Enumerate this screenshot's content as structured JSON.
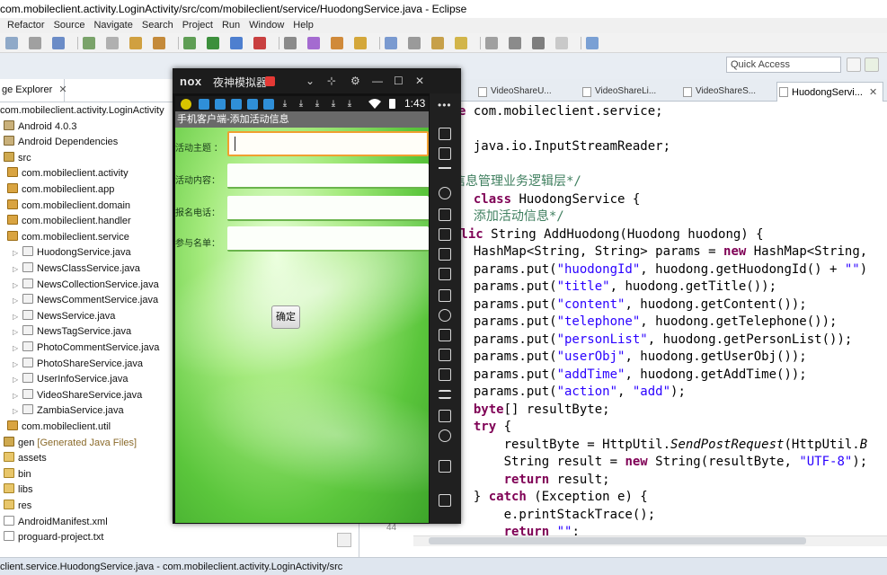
{
  "window": {
    "title": "com.mobileclient.activity.LoginActivity/src/com/mobileclient/service/HuodongService.java - Eclipse"
  },
  "menu": [
    "Refactor",
    "Source",
    "Navigate",
    "Search",
    "Project",
    "Run",
    "Window",
    "Help"
  ],
  "quick_access": {
    "placeholder": "Quick Access"
  },
  "package_explorer": {
    "tab_label": "ge Explorer",
    "close": "✕",
    "items": [
      {
        "label": "com.mobileclient.activity.LoginActivity",
        "kind": "project",
        "indent": 0
      },
      {
        "label": "Android 4.0.3",
        "kind": "lib",
        "indent": 1
      },
      {
        "label": "Android Dependencies",
        "kind": "lib",
        "indent": 1
      },
      {
        "label": "src",
        "kind": "src",
        "indent": 1
      },
      {
        "label": "com.mobileclient.activity",
        "kind": "pkg",
        "indent": 2
      },
      {
        "label": "com.mobileclient.app",
        "kind": "pkg",
        "indent": 2
      },
      {
        "label": "com.mobileclient.domain",
        "kind": "pkg",
        "indent": 2
      },
      {
        "label": "com.mobileclient.handler",
        "kind": "pkg",
        "indent": 2
      },
      {
        "label": "com.mobileclient.service",
        "kind": "pkg",
        "indent": 2
      },
      {
        "label": "HuodongService.java",
        "kind": "java",
        "indent": 3
      },
      {
        "label": "NewsClassService.java",
        "kind": "java",
        "indent": 3
      },
      {
        "label": "NewsCollectionService.java",
        "kind": "java",
        "indent": 3
      },
      {
        "label": "NewsCommentService.java",
        "kind": "java",
        "indent": 3
      },
      {
        "label": "NewsService.java",
        "kind": "java",
        "indent": 3
      },
      {
        "label": "NewsTagService.java",
        "kind": "java",
        "indent": 3
      },
      {
        "label": "PhotoCommentService.java",
        "kind": "java",
        "indent": 3
      },
      {
        "label": "PhotoShareService.java",
        "kind": "java",
        "indent": 3
      },
      {
        "label": "UserInfoService.java",
        "kind": "java",
        "indent": 3
      },
      {
        "label": "VideoShareService.java",
        "kind": "java",
        "indent": 3
      },
      {
        "label": "ZambiaService.java",
        "kind": "java",
        "indent": 3
      },
      {
        "label": "com.mobileclient.util",
        "kind": "pkg",
        "indent": 2
      },
      {
        "label": "gen",
        "extra": "[Generated Java Files]",
        "kind": "src",
        "indent": 1
      },
      {
        "label": "assets",
        "kind": "folder",
        "indent": 1
      },
      {
        "label": "bin",
        "kind": "folder",
        "indent": 1
      },
      {
        "label": "libs",
        "kind": "folder",
        "indent": 1
      },
      {
        "label": "res",
        "kind": "folder",
        "indent": 1
      },
      {
        "label": "AndroidManifest.xml",
        "kind": "file",
        "indent": 1
      },
      {
        "label": "proguard-project.txt",
        "kind": "file",
        "indent": 1
      }
    ]
  },
  "editor": {
    "tabs": [
      "VideoShareU...",
      "VideoShareLi...",
      "VideoShareS...",
      "HuodongServi..."
    ],
    "tab_close": "✕",
    "lines": [
      [
        {
          "t": "e ",
          "c": "kw"
        },
        {
          "t": "com.mobileclient.service;",
          "c": ""
        }
      ],
      [],
      [
        {
          "t": "  java.io.InputStreamReader;",
          "c": ""
        }
      ],
      [],
      [
        {
          "t": "信息管理业务逻辑层*/",
          "c": "cm"
        }
      ],
      [
        {
          "t": "  ",
          "c": ""
        },
        {
          "t": "class",
          "c": "kw"
        },
        {
          "t": " HuodongService {",
          "c": ""
        }
      ],
      [
        {
          "t": "  添加活动信息*/",
          "c": "cm"
        }
      ],
      [
        {
          "t": "blic",
          "c": "kw"
        },
        {
          "t": " String AddHuodong(Huodong huodong) {",
          "c": ""
        }
      ],
      [
        {
          "t": "  HashMap<String, String> params = ",
          "c": ""
        },
        {
          "t": "new",
          "c": "kw"
        },
        {
          "t": " HashMap<String, ",
          "c": ""
        }
      ],
      [
        {
          "t": "  params.put(",
          "c": ""
        },
        {
          "t": "\"huodongId\"",
          "c": "st"
        },
        {
          "t": ", huodong.getHuodongId() + ",
          "c": ""
        },
        {
          "t": "\"\"",
          "c": "st"
        },
        {
          "t": ")",
          "c": ""
        }
      ],
      [
        {
          "t": "  params.put(",
          "c": ""
        },
        {
          "t": "\"title\"",
          "c": "st"
        },
        {
          "t": ", huodong.getTitle());",
          "c": ""
        }
      ],
      [
        {
          "t": "  params.put(",
          "c": ""
        },
        {
          "t": "\"content\"",
          "c": "st"
        },
        {
          "t": ", huodong.getContent());",
          "c": ""
        }
      ],
      [
        {
          "t": "  params.put(",
          "c": ""
        },
        {
          "t": "\"telephone\"",
          "c": "st"
        },
        {
          "t": ", huodong.getTelephone());",
          "c": ""
        }
      ],
      [
        {
          "t": "  params.put(",
          "c": ""
        },
        {
          "t": "\"personList\"",
          "c": "st"
        },
        {
          "t": ", huodong.getPersonList());",
          "c": ""
        }
      ],
      [
        {
          "t": "  params.put(",
          "c": ""
        },
        {
          "t": "\"userObj\"",
          "c": "st"
        },
        {
          "t": ", huodong.getUserObj());",
          "c": ""
        }
      ],
      [
        {
          "t": "  params.put(",
          "c": ""
        },
        {
          "t": "\"addTime\"",
          "c": "st"
        },
        {
          "t": ", huodong.getAddTime());",
          "c": ""
        }
      ],
      [
        {
          "t": "  params.put(",
          "c": ""
        },
        {
          "t": "\"action\"",
          "c": "st"
        },
        {
          "t": ", ",
          "c": ""
        },
        {
          "t": "\"add\"",
          "c": "st"
        },
        {
          "t": ");",
          "c": ""
        }
      ],
      [
        {
          "t": "  ",
          "c": ""
        },
        {
          "t": "byte",
          "c": "kw"
        },
        {
          "t": "[] resultByte;",
          "c": ""
        }
      ],
      [
        {
          "t": "  ",
          "c": ""
        },
        {
          "t": "try",
          "c": "kw"
        },
        {
          "t": " {",
          "c": ""
        }
      ],
      [
        {
          "t": "      resultByte = HttpUtil.",
          "c": ""
        },
        {
          "t": "SendPostRequest",
          "c": "it"
        },
        {
          "t": "(HttpUtil.",
          "c": ""
        },
        {
          "t": "B",
          "c": "it"
        }
      ],
      [
        {
          "t": "      String result = ",
          "c": ""
        },
        {
          "t": "new",
          "c": "kw"
        },
        {
          "t": " String(resultByte, ",
          "c": ""
        },
        {
          "t": "\"UTF-8\"",
          "c": "st"
        },
        {
          "t": ");",
          "c": ""
        }
      ],
      [
        {
          "t": "      ",
          "c": ""
        },
        {
          "t": "return",
          "c": "kw"
        },
        {
          "t": " result;",
          "c": ""
        }
      ],
      [
        {
          "t": "  } ",
          "c": ""
        },
        {
          "t": "catch",
          "c": "kw"
        },
        {
          "t": " (Exception e) {",
          "c": ""
        }
      ],
      [
        {
          "t": "      e.printStackTrace();",
          "c": ""
        }
      ],
      [
        {
          "t": "      ",
          "c": ""
        },
        {
          "t": "return",
          "c": "kw"
        },
        {
          "t": " ",
          "c": ""
        },
        {
          "t": "\"\"",
          "c": "st"
        },
        {
          "t": ";",
          "c": ""
        }
      ]
    ],
    "ruler_number": "44"
  },
  "status_bar": {
    "text": "client.service.HuodongService.java - com.mobileclient.activity.LoginActivity/src"
  },
  "emulator": {
    "logo": "nox",
    "name": "夜神模拟器",
    "time": "1:43",
    "side_more": "•••",
    "app": {
      "title": "手机客户端-添加活动信息",
      "fields": [
        {
          "label": "活动主题 ："
        },
        {
          "label": "活动内容："
        },
        {
          "label": "报名电话："
        },
        {
          "label": "参与名单："
        }
      ],
      "confirm_label": "确定"
    }
  },
  "colors": {
    "keyword": "#7f0055",
    "string": "#2a00ff",
    "comment": "#3f7f5f",
    "emulator_bg": "#111111",
    "app_green": "#5bc63c"
  }
}
